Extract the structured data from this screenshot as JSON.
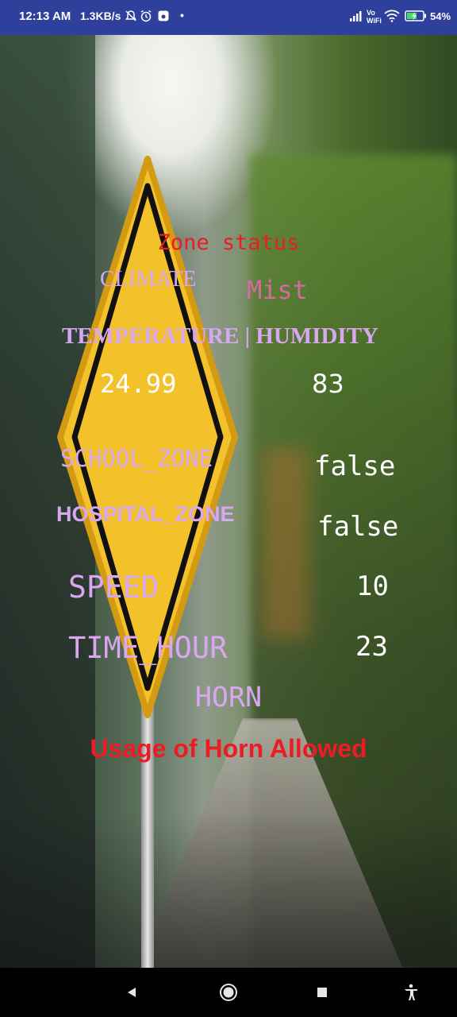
{
  "status_bar": {
    "time": "12:13 AM",
    "net_speed": "1.3KB/s",
    "battery_pct": "54",
    "icons": [
      "mute-icon",
      "alarm-icon",
      "notification-icon",
      "dot-icon",
      "signal-icon",
      "volte-wifi-icon",
      "wifi-icon",
      "battery-charging-icon"
    ]
  },
  "zone": {
    "title": "Zone status",
    "climate_label": "CLIMATE",
    "climate_value": "Mist",
    "temp_humidity_label": "TEMPERATURE | HUMIDITY",
    "temperature_value": "24.99",
    "humidity_value": "83",
    "school_zone_label": "SCHOOL_ZONE",
    "school_zone_value": "false",
    "hospital_zone_label": "HOSPITAL_ZONE",
    "hospital_zone_value": "false",
    "speed_label": "SPEED",
    "speed_value": "10",
    "time_hour_label": "TIME_HOUR",
    "time_hour_value": "23",
    "horn_label": "HORN",
    "horn_message": "Usage of Horn Allowed"
  },
  "nav": {
    "back": "back-icon",
    "home": "home-icon",
    "recents": "recents-icon",
    "accessibility": "accessibility-icon"
  },
  "colors": {
    "status_bar": "#2f3f9c",
    "label": "#d9a6f0",
    "climate_value": "#d66aa0",
    "alert": "#ec1c24",
    "sign_yellow": "#f3c12a"
  }
}
